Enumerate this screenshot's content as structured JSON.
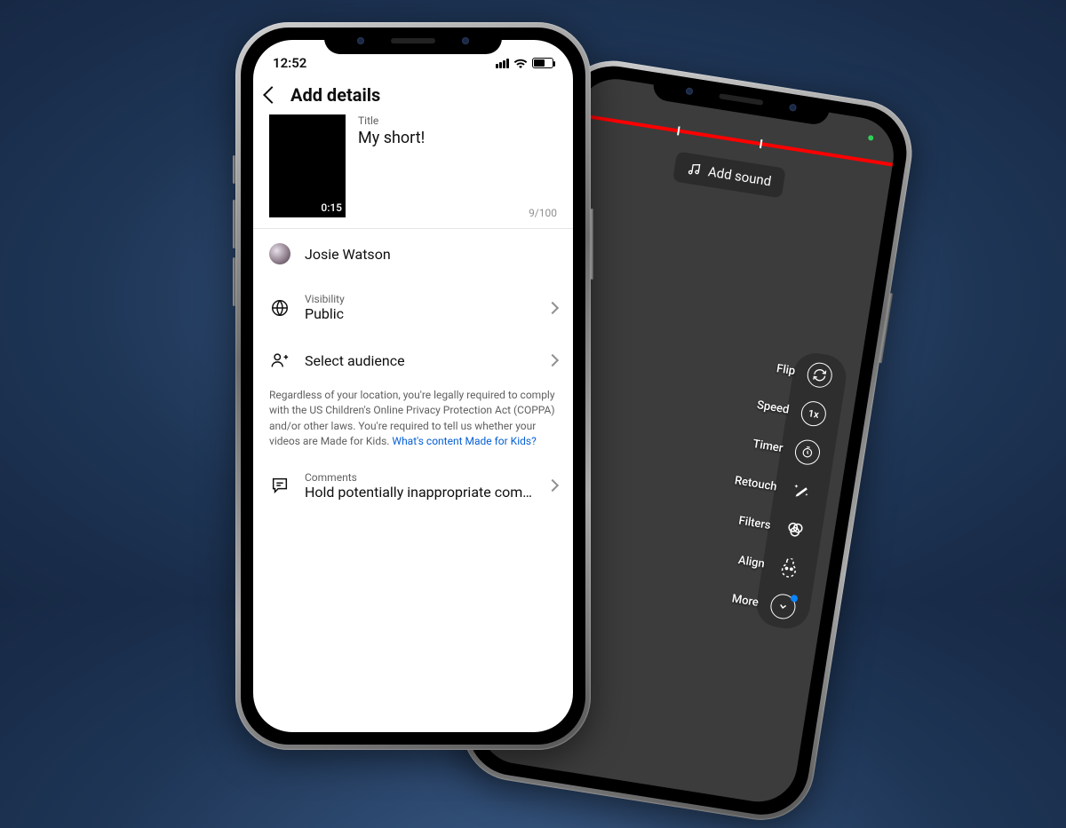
{
  "front": {
    "status": {
      "time": "12:52"
    },
    "header": {
      "title": "Add details"
    },
    "title_block": {
      "label": "Title",
      "value": "My short!",
      "duration": "0:15",
      "char_count": "9/100"
    },
    "author": {
      "name": "Josie Watson"
    },
    "visibility": {
      "label": "Visibility",
      "value": "Public"
    },
    "audience": {
      "label": "Select audience"
    },
    "legal": {
      "text": "Regardless of your location, you're legally required to comply with the US Children's Online Privacy Protection Act (COPPA) and/or other laws. You're required to tell us whether your videos are Made for Kids. ",
      "link": "What's content Made for Kids?"
    },
    "comments": {
      "label": "Comments",
      "value": "Hold potentially inappropriate com…"
    }
  },
  "back": {
    "add_sound": "Add sound",
    "tools": {
      "flip": "Flip",
      "speed": "Speed",
      "timer": "Timer",
      "retouch": "Retouch",
      "filters": "Filters",
      "align": "Align",
      "more": "More"
    }
  }
}
